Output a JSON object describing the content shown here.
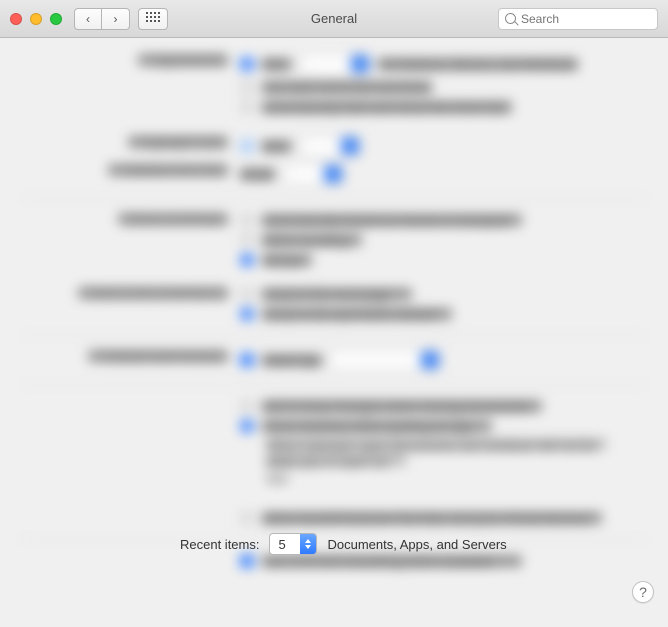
{
  "window": {
    "title": "General",
    "search_placeholder": "Search"
  },
  "recent_items": {
    "label": "Recent items:",
    "value": "5",
    "suffix": "Documents, Apps, and Servers"
  },
  "help": {
    "glyph": "?"
  },
  "blurred": {
    "appearance": {
      "label": "Appearance:",
      "value": "Blue",
      "desc": "For Buttons, Menus, and Windows",
      "opt1": "Use dark menu bar and Dock",
      "opt2": "Automatically hide and show the menu bar"
    },
    "highlight": {
      "label": "Highlight color:",
      "value": "Blue"
    },
    "sidebar": {
      "label": "Sidebar icon size:",
      "value": "Small"
    },
    "scroll": {
      "label": "Show scroll bars:",
      "r1": "Automatically based on mouse or trackpad",
      "r2": "When scrolling",
      "r3": "Always"
    },
    "click": {
      "label": "Click in the scroll bar to:",
      "r1": "Jump to the next page",
      "r2": "Jump to the spot that's clicked"
    },
    "browser": {
      "label": "Default web browser:",
      "value": "Safari.app"
    },
    "docs": {
      "c1": "Ask to keep changes when closing documents",
      "c2": "Close windows when quitting an app",
      "note1": "When selected, open documents and windows will not be restored",
      "note2": "when you re-open an app."
    },
    "handoff": {
      "label": "Allow Handoff between this Mac and your iCloud devices"
    },
    "lcd": {
      "label": "Use LCD font smoothing when available"
    }
  }
}
